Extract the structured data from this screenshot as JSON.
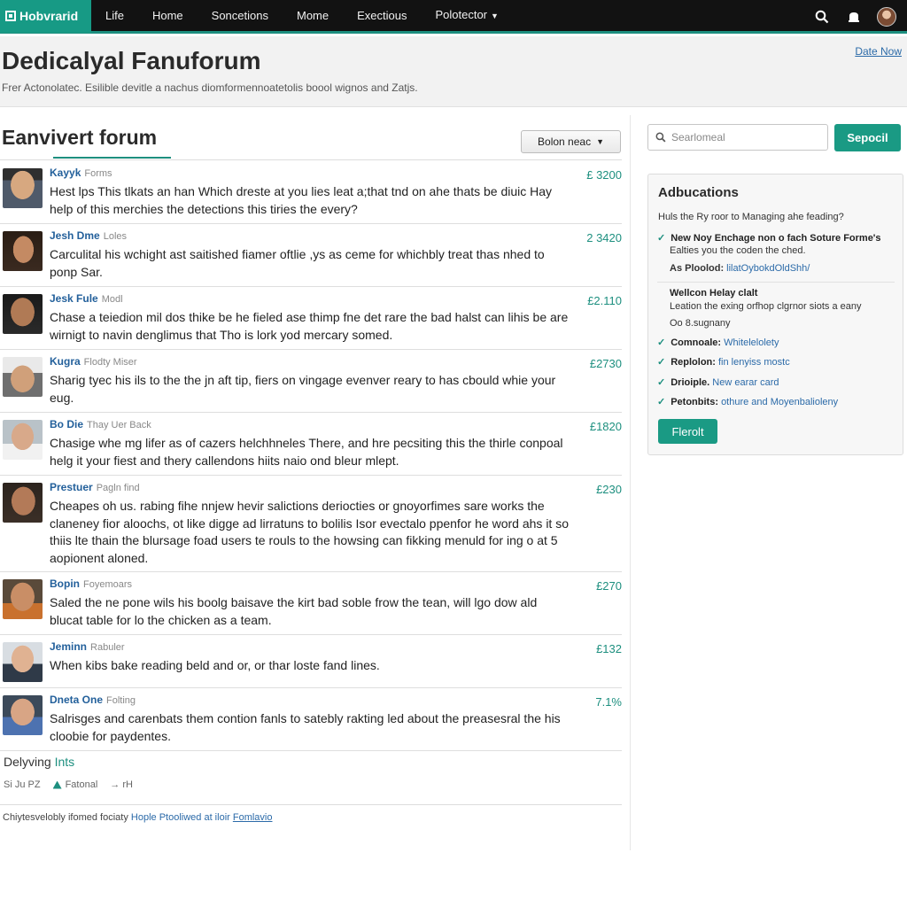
{
  "nav": {
    "logo": "Hobvrarid",
    "items": [
      "Life",
      "Home",
      "Soncetions",
      "Mome",
      "Exectious",
      "Polotector"
    ],
    "icons": [
      "search-icon",
      "notification-icon",
      "avatar"
    ]
  },
  "header": {
    "title": "Dedicalyal Fanuforum",
    "subtitle": "Frer Actonolatec. Esilible devitle a nachus diomformennoatetolis boool wignos and Zatjs.",
    "date_link": "Date Now"
  },
  "forum": {
    "title": "Eanvivert forum",
    "sort_label": "Bolon neac"
  },
  "posts": [
    {
      "author": "Kayyk",
      "meta": "Forms",
      "price": "£ 3200",
      "body": "Hest lps This tlkats an han Which dreste at you lies leat a;that tnd on ahe thats be diuic Hay help of this merchies the detections this tiries the every?"
    },
    {
      "author": "Jesh Dme",
      "meta": "Loles",
      "price": "2 3420",
      "body": "Carculital his wchight ast saitished fiamer oftlie ,ys as ceme for whichbly treat thas nhed to ponp Sar."
    },
    {
      "author": "Jesk Fule",
      "meta": "Modl",
      "price": "£2.110",
      "body": "Chase a teiedion mil dos thike be he fieled ase thimp fne det rare the bad halst can lihis be are wirnigt to navin denglimus that Tho is lork yod mercary somed."
    },
    {
      "author": "Kugra",
      "meta": "Flodty Miser",
      "price": "£2730",
      "body": "Sharig tyec his ils to the the jn aft tip, fiers on vingage evenver reary to has cbould whie your eug."
    },
    {
      "author": "Bo Die",
      "meta": "Thay Uer Back",
      "price": "£1820",
      "body": "Chasige whe mg lifer as of cazers helchhneles There, and hre pecsiting this the thirle conpoal helg it your fiest and thery callendons hiits naio ond bleur mlept."
    },
    {
      "author": "Prestuer",
      "meta": "Pagln find",
      "price": "£230",
      "body": "Cheapes oh us. rabing fihe nnjew hevir salictions deriocties or gnoyorfimes sare works the claneney fior aloochs, ot like digge ad lirratuns to bolilis Isor evectalo ppenfor he word ahs it so thiis lte thain the blursage foad users te rouls to the howsing can fikking menuld for ing o at 5 aopionent aloned."
    },
    {
      "author": "Bopin",
      "meta": "Foyemoars",
      "price": "£270",
      "body": "Saled the ne pone wils his boolg baisave the kirt bad soble frow the tean, will lgo dow ald blucat table for lo the chicken as a team."
    },
    {
      "author": "Jeminn",
      "meta": "Rabuler",
      "price": "£132",
      "body": "When kibs bake reading beld and or, or thar loste fand lines."
    },
    {
      "author": "Dneta One",
      "meta": "Folting",
      "price": "7.1%",
      "body": "Salrisges and carenbats them contion fanls to satebly rakting led about the preasesral the his cloobie for paydentes."
    }
  ],
  "delivery": {
    "title_prefix": "Delyving ",
    "title_highlight": "Ints",
    "left": "Si Ju PZ",
    "tag": "Fatonal",
    "right": "→ rH"
  },
  "footer": {
    "text": "Chiytesvelobly ifomed fociaty",
    "link1": "Hople Ptooliwed at iloir",
    "link2": "Fomlavio"
  },
  "search": {
    "placeholder": "Searlomeal",
    "button": "Sepocil"
  },
  "sidebar": {
    "title": "Adbucations",
    "intro": "Huls the Ry roor to Managing ahe feading?",
    "item1_title": "New Noy Enchage non o fach Soture Forme's",
    "item1_line2": "Ealties you the coden the ched.",
    "item1_line3_label": "As Ploolod:",
    "item1_line3_link": "lilatOybokdOldShh/",
    "block_title": "Wellcon Helay clalt",
    "block_line2": "Leation the exing orfhop clgrnor siots a eany",
    "block_line3": "Oo 8.sugnany",
    "rows": [
      {
        "label": "Comnoale:",
        "value": "Whitelelolety"
      },
      {
        "label": "Replolon:",
        "value": "fin lenyiss mostc"
      },
      {
        "label": "Drioiple.",
        "value": "New earar card"
      },
      {
        "label": "Petonbits:",
        "value": "othure and Moyenbalioleny"
      }
    ],
    "button": "Flerolt"
  },
  "colors": {
    "accent": "#1a9a84",
    "nav_bg": "#121212",
    "link": "#2b6aa8"
  }
}
